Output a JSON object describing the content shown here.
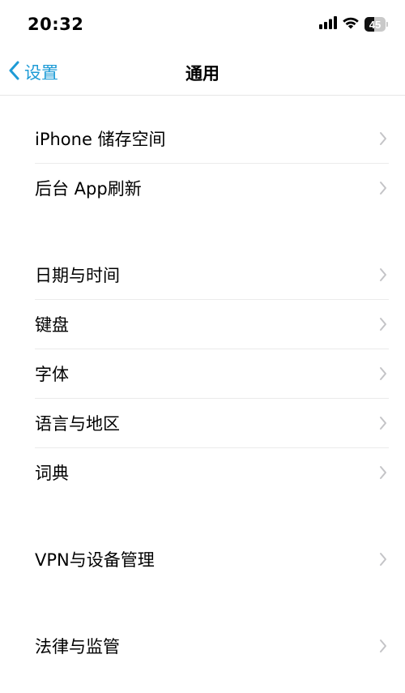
{
  "status_bar": {
    "time": "20:32",
    "battery_level": "45",
    "battery_fraction": 0.45
  },
  "nav": {
    "back_label": "设置",
    "title": "通用"
  },
  "groups": [
    {
      "items": [
        {
          "label": "iPhone 储存空间"
        },
        {
          "label": "后台 App刷新"
        }
      ]
    },
    {
      "items": [
        {
          "label": "日期与时间"
        },
        {
          "label": "键盘"
        },
        {
          "label": "字体"
        },
        {
          "label": "语言与地区"
        },
        {
          "label": "词典"
        }
      ]
    },
    {
      "items": [
        {
          "label": "VPN与设备管理"
        }
      ]
    },
    {
      "items": [
        {
          "label": "法律与监管"
        }
      ]
    }
  ],
  "colors": {
    "accent": "#1e9bd6",
    "chevron": "#c4c4c7",
    "separator": "#ebebeb"
  },
  "icons": {
    "back": "chevron-left-icon",
    "row": "chevron-right-icon",
    "signal": "cellular-signal-icon",
    "wifi": "wifi-icon",
    "battery": "battery-icon"
  }
}
